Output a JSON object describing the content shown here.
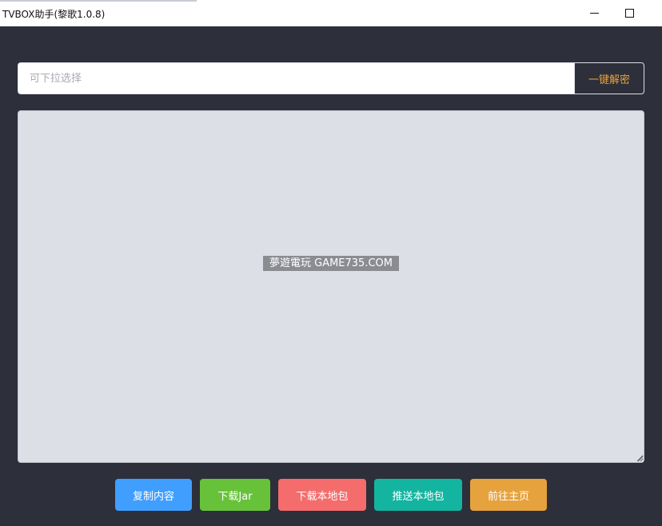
{
  "window": {
    "title": "TVBOX助手(黎歌1.0.8)",
    "minimize_icon": "minimize-icon",
    "maximize_icon": "maximize-icon"
  },
  "search": {
    "placeholder": "可下拉选择",
    "value": "",
    "decrypt_label": "一键解密",
    "decrypt_color": "#e6a23c"
  },
  "content": {
    "text": ""
  },
  "watermark": {
    "text": "夢遊電玩 GAME735.COM"
  },
  "actions": [
    {
      "label": "复制内容",
      "color": "#409eff"
    },
    {
      "label": "下载Jar",
      "color": "#67c23a"
    },
    {
      "label": "下载本地包",
      "color": "#f56c6c"
    },
    {
      "label": "推送本地包",
      "color": "#13b5a0"
    },
    {
      "label": "前往主页",
      "color": "#e6a23c"
    }
  ],
  "colors": {
    "background": "#2d2f3b",
    "textarea_bg": "#dcdfe6"
  }
}
